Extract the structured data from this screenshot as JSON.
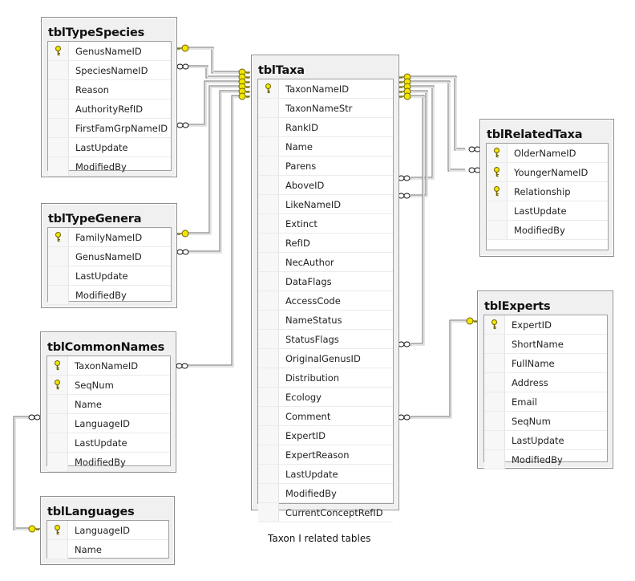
{
  "caption": "Taxon I related tables",
  "colors": {
    "key": "#f2e600",
    "line_dark": "#6e6e6e",
    "line_light": "#c8c8c8",
    "table_bg": "#f0f0f0"
  },
  "tables": {
    "tblTypeSpecies": {
      "title": "tblTypeSpecies",
      "columns": [
        {
          "name": "GenusNameID",
          "pk": true
        },
        {
          "name": "SpeciesNameID",
          "pk": false
        },
        {
          "name": "Reason",
          "pk": false
        },
        {
          "name": "AuthorityRefID",
          "pk": false
        },
        {
          "name": "FirstFamGrpNameID",
          "pk": false
        },
        {
          "name": "LastUpdate",
          "pk": false
        },
        {
          "name": "ModifiedBy",
          "pk": false
        }
      ]
    },
    "tblTypeGenera": {
      "title": "tblTypeGenera",
      "columns": [
        {
          "name": "FamilyNameID",
          "pk": true
        },
        {
          "name": "GenusNameID",
          "pk": false
        },
        {
          "name": "LastUpdate",
          "pk": false
        },
        {
          "name": "ModifiedBy",
          "pk": false
        }
      ]
    },
    "tblCommonNames": {
      "title": "tblCommonNames",
      "columns": [
        {
          "name": "TaxonNameID",
          "pk": true
        },
        {
          "name": "SeqNum",
          "pk": true
        },
        {
          "name": "Name",
          "pk": false
        },
        {
          "name": "LanguageID",
          "pk": false
        },
        {
          "name": "LastUpdate",
          "pk": false
        },
        {
          "name": "ModifiedBy",
          "pk": false
        }
      ]
    },
    "tblLanguages": {
      "title": "tblLanguages",
      "columns": [
        {
          "name": "LanguageID",
          "pk": true
        },
        {
          "name": "Name",
          "pk": false
        }
      ]
    },
    "tblTaxa": {
      "title": "tblTaxa",
      "columns": [
        {
          "name": "TaxonNameID",
          "pk": true
        },
        {
          "name": "TaxonNameStr",
          "pk": false
        },
        {
          "name": "RankID",
          "pk": false
        },
        {
          "name": "Name",
          "pk": false
        },
        {
          "name": "Parens",
          "pk": false
        },
        {
          "name": "AboveID",
          "pk": false
        },
        {
          "name": "LikeNameID",
          "pk": false
        },
        {
          "name": "Extinct",
          "pk": false
        },
        {
          "name": "RefID",
          "pk": false
        },
        {
          "name": "NecAuthor",
          "pk": false
        },
        {
          "name": "DataFlags",
          "pk": false
        },
        {
          "name": "AccessCode",
          "pk": false
        },
        {
          "name": "NameStatus",
          "pk": false
        },
        {
          "name": "StatusFlags",
          "pk": false
        },
        {
          "name": "OriginalGenusID",
          "pk": false
        },
        {
          "name": "Distribution",
          "pk": false
        },
        {
          "name": "Ecology",
          "pk": false
        },
        {
          "name": "Comment",
          "pk": false
        },
        {
          "name": "ExpertID",
          "pk": false
        },
        {
          "name": "ExpertReason",
          "pk": false
        },
        {
          "name": "LastUpdate",
          "pk": false
        },
        {
          "name": "ModifiedBy",
          "pk": false
        },
        {
          "name": "CurrentConceptRefID",
          "pk": false
        }
      ]
    },
    "tblRelatedTaxa": {
      "title": "tblRelatedTaxa",
      "columns": [
        {
          "name": "OlderNameID",
          "pk": true
        },
        {
          "name": "YoungerNameID",
          "pk": true
        },
        {
          "name": "Relationship",
          "pk": true
        },
        {
          "name": "LastUpdate",
          "pk": false
        },
        {
          "name": "ModifiedBy",
          "pk": false
        }
      ]
    },
    "tblExperts": {
      "title": "tblExperts",
      "columns": [
        {
          "name": "ExpertID",
          "pk": true
        },
        {
          "name": "ShortName",
          "pk": false
        },
        {
          "name": "FullName",
          "pk": false
        },
        {
          "name": "Address",
          "pk": false
        },
        {
          "name": "Email",
          "pk": false
        },
        {
          "name": "SeqNum",
          "pk": false
        },
        {
          "name": "LastUpdate",
          "pk": false
        },
        {
          "name": "ModifiedBy",
          "pk": false
        }
      ]
    }
  },
  "relationships": [
    {
      "from": "tblTaxa.TaxonNameID",
      "to": "tblTypeSpecies.GenusNameID",
      "one_end": "tblTaxa",
      "many_end": "tblTypeSpecies",
      "one_end_icon": "key-icon",
      "many_end_icon": "key-icon"
    },
    {
      "from": "tblTaxa.TaxonNameID",
      "to": "tblTypeSpecies.SpeciesNameID",
      "one_end": "tblTaxa",
      "many_end": "tblTypeSpecies"
    },
    {
      "from": "tblTaxa.TaxonNameID",
      "to": "tblTypeSpecies.FirstFamGrpNameID",
      "one_end": "tblTaxa",
      "many_end": "tblTypeSpecies"
    },
    {
      "from": "tblTaxa.TaxonNameID",
      "to": "tblTypeGenera.FamilyNameID",
      "one_end": "tblTaxa",
      "many_end": "tblTypeGenera"
    },
    {
      "from": "tblTaxa.TaxonNameID",
      "to": "tblTypeGenera.GenusNameID",
      "one_end": "tblTaxa",
      "many_end": "tblTypeGenera"
    },
    {
      "from": "tblTaxa.TaxonNameID",
      "to": "tblCommonNames.TaxonNameID",
      "one_end": "tblTaxa",
      "many_end": "tblCommonNames"
    },
    {
      "from": "tblTaxa.TaxonNameID",
      "to": "tblTaxa.AboveID",
      "one_end": "tblTaxa",
      "many_end": "tblTaxa"
    },
    {
      "from": "tblTaxa.TaxonNameID",
      "to": "tblTaxa.LikeNameID",
      "one_end": "tblTaxa",
      "many_end": "tblTaxa"
    },
    {
      "from": "tblTaxa.TaxonNameID",
      "to": "tblTaxa.OriginalGenusID",
      "one_end": "tblTaxa",
      "many_end": "tblTaxa"
    },
    {
      "from": "tblTaxa.TaxonNameID",
      "to": "tblRelatedTaxa.OlderNameID",
      "one_end": "tblTaxa",
      "many_end": "tblRelatedTaxa"
    },
    {
      "from": "tblTaxa.TaxonNameID",
      "to": "tblRelatedTaxa.YoungerNameID",
      "one_end": "tblTaxa",
      "many_end": "tblRelatedTaxa"
    },
    {
      "from": "tblExperts.ExpertID",
      "to": "tblTaxa.ExpertID",
      "one_end": "tblExperts",
      "many_end": "tblTaxa"
    },
    {
      "from": "tblLanguages.LanguageID",
      "to": "tblCommonNames.LanguageID",
      "one_end": "tblLanguages",
      "many_end": "tblCommonNames"
    }
  ]
}
